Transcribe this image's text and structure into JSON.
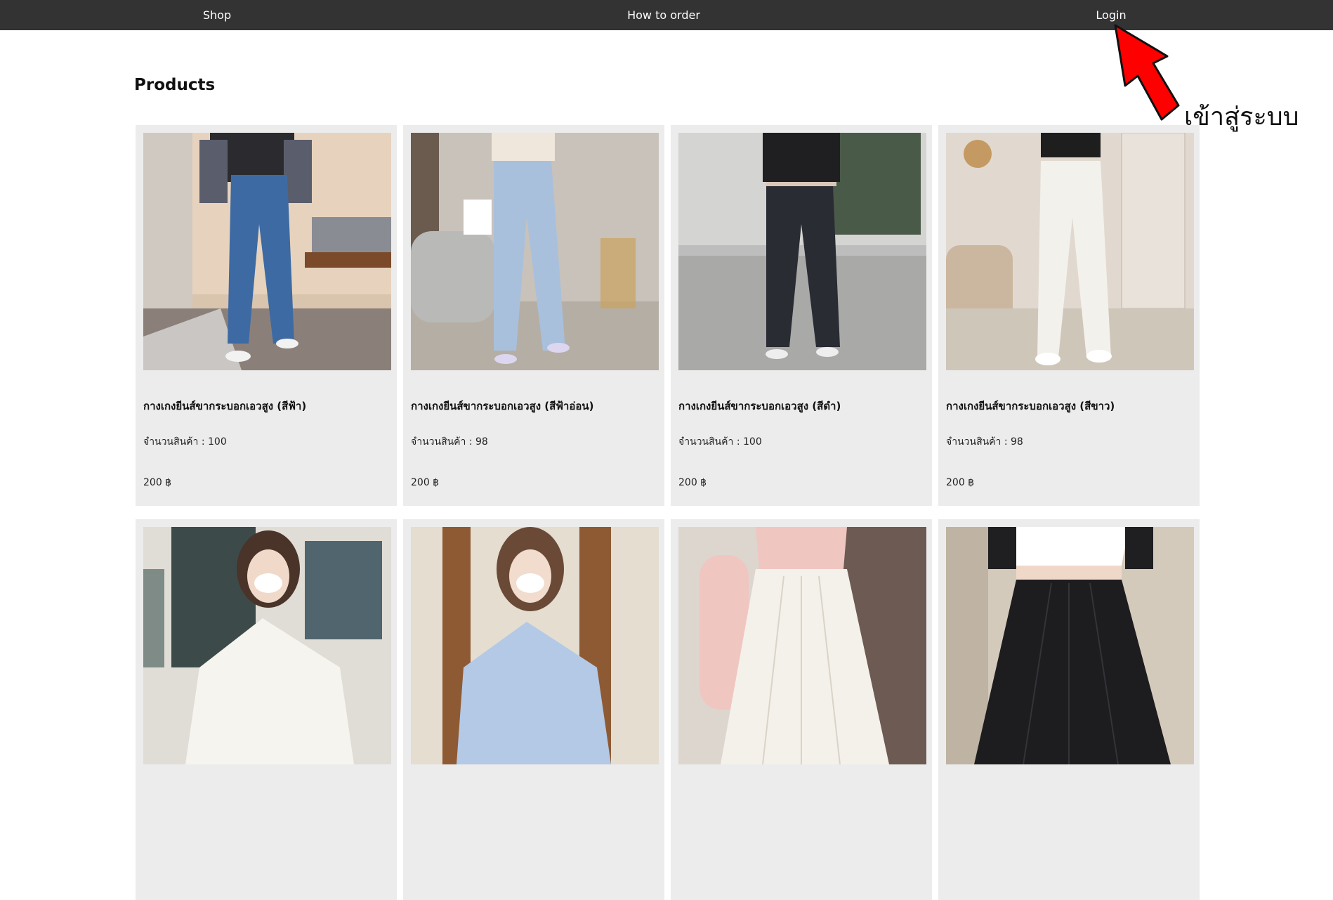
{
  "nav": {
    "links": [
      {
        "label": "Shop"
      },
      {
        "label": "How to order"
      },
      {
        "label": "Login"
      }
    ]
  },
  "page": {
    "title": "Products"
  },
  "annotation": {
    "text": "เข้าสู่ระบบ",
    "arrow_color": "#ff0000",
    "icon": "red-arrow-icon"
  },
  "products": [
    {
      "name": "กางเกงยีนส์ขากระบอกเอวสูง (สีฟ้า)",
      "qty": "จำนวนสินค้า : 100",
      "price": "200 ฿",
      "image": "model-blue-jeans-photo"
    },
    {
      "name": "กางเกงยีนส์ขากระบอกเอวสูง (สีฟ้าอ่อน)",
      "qty": "จำนวนสินค้า : 98",
      "price": "200 ฿",
      "image": "model-light-blue-jeans-photo"
    },
    {
      "name": "กางเกงยีนส์ขากระบอกเอวสูง (สีดำ)",
      "qty": "จำนวนสินค้า : 100",
      "price": "200 ฿",
      "image": "model-black-jeans-photo"
    },
    {
      "name": "กางเกงยีนส์ขากระบอกเอวสูง (สีขาว)",
      "qty": "จำนวนสินค้า : 98",
      "price": "200 ฿",
      "image": "model-white-jeans-photo"
    },
    {
      "name": "",
      "qty": "",
      "price": "",
      "image": "model-white-shirt-photo"
    },
    {
      "name": "",
      "qty": "",
      "price": "",
      "image": "model-blue-shirt-photo"
    },
    {
      "name": "",
      "qty": "",
      "price": "",
      "image": "white-pleated-skirt-photo"
    },
    {
      "name": "",
      "qty": "",
      "price": "",
      "image": "black-pleated-skirt-photo"
    }
  ],
  "colors": {
    "nav_bg": "#333333",
    "card_bg": "#ececec",
    "text": "#111111"
  }
}
